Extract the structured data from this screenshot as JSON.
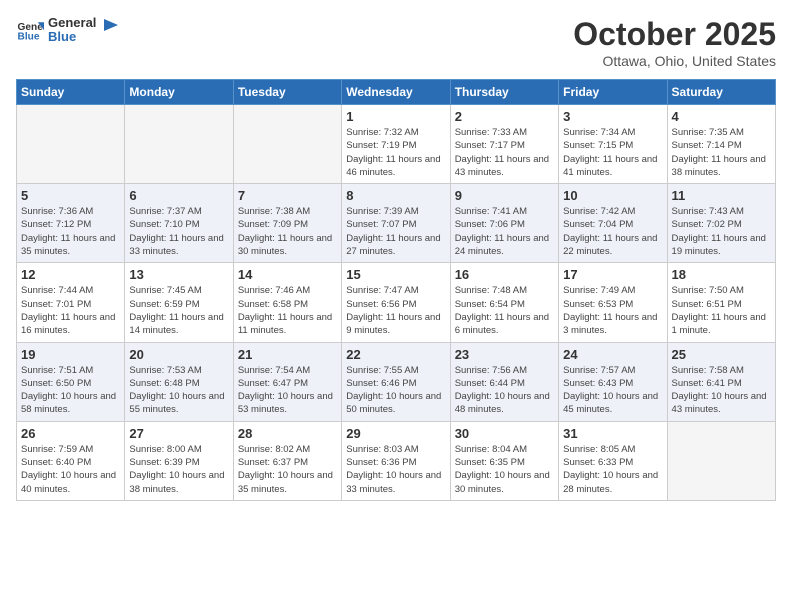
{
  "logo": {
    "general": "General",
    "blue": "Blue"
  },
  "header": {
    "month": "October 2025",
    "location": "Ottawa, Ohio, United States"
  },
  "weekdays": [
    "Sunday",
    "Monday",
    "Tuesday",
    "Wednesday",
    "Thursday",
    "Friday",
    "Saturday"
  ],
  "weeks": [
    [
      {
        "day": "",
        "info": ""
      },
      {
        "day": "",
        "info": ""
      },
      {
        "day": "",
        "info": ""
      },
      {
        "day": "1",
        "info": "Sunrise: 7:32 AM\nSunset: 7:19 PM\nDaylight: 11 hours and 46 minutes."
      },
      {
        "day": "2",
        "info": "Sunrise: 7:33 AM\nSunset: 7:17 PM\nDaylight: 11 hours and 43 minutes."
      },
      {
        "day": "3",
        "info": "Sunrise: 7:34 AM\nSunset: 7:15 PM\nDaylight: 11 hours and 41 minutes."
      },
      {
        "day": "4",
        "info": "Sunrise: 7:35 AM\nSunset: 7:14 PM\nDaylight: 11 hours and 38 minutes."
      }
    ],
    [
      {
        "day": "5",
        "info": "Sunrise: 7:36 AM\nSunset: 7:12 PM\nDaylight: 11 hours and 35 minutes."
      },
      {
        "day": "6",
        "info": "Sunrise: 7:37 AM\nSunset: 7:10 PM\nDaylight: 11 hours and 33 minutes."
      },
      {
        "day": "7",
        "info": "Sunrise: 7:38 AM\nSunset: 7:09 PM\nDaylight: 11 hours and 30 minutes."
      },
      {
        "day": "8",
        "info": "Sunrise: 7:39 AM\nSunset: 7:07 PM\nDaylight: 11 hours and 27 minutes."
      },
      {
        "day": "9",
        "info": "Sunrise: 7:41 AM\nSunset: 7:06 PM\nDaylight: 11 hours and 24 minutes."
      },
      {
        "day": "10",
        "info": "Sunrise: 7:42 AM\nSunset: 7:04 PM\nDaylight: 11 hours and 22 minutes."
      },
      {
        "day": "11",
        "info": "Sunrise: 7:43 AM\nSunset: 7:02 PM\nDaylight: 11 hours and 19 minutes."
      }
    ],
    [
      {
        "day": "12",
        "info": "Sunrise: 7:44 AM\nSunset: 7:01 PM\nDaylight: 11 hours and 16 minutes."
      },
      {
        "day": "13",
        "info": "Sunrise: 7:45 AM\nSunset: 6:59 PM\nDaylight: 11 hours and 14 minutes."
      },
      {
        "day": "14",
        "info": "Sunrise: 7:46 AM\nSunset: 6:58 PM\nDaylight: 11 hours and 11 minutes."
      },
      {
        "day": "15",
        "info": "Sunrise: 7:47 AM\nSunset: 6:56 PM\nDaylight: 11 hours and 9 minutes."
      },
      {
        "day": "16",
        "info": "Sunrise: 7:48 AM\nSunset: 6:54 PM\nDaylight: 11 hours and 6 minutes."
      },
      {
        "day": "17",
        "info": "Sunrise: 7:49 AM\nSunset: 6:53 PM\nDaylight: 11 hours and 3 minutes."
      },
      {
        "day": "18",
        "info": "Sunrise: 7:50 AM\nSunset: 6:51 PM\nDaylight: 11 hours and 1 minute."
      }
    ],
    [
      {
        "day": "19",
        "info": "Sunrise: 7:51 AM\nSunset: 6:50 PM\nDaylight: 10 hours and 58 minutes."
      },
      {
        "day": "20",
        "info": "Sunrise: 7:53 AM\nSunset: 6:48 PM\nDaylight: 10 hours and 55 minutes."
      },
      {
        "day": "21",
        "info": "Sunrise: 7:54 AM\nSunset: 6:47 PM\nDaylight: 10 hours and 53 minutes."
      },
      {
        "day": "22",
        "info": "Sunrise: 7:55 AM\nSunset: 6:46 PM\nDaylight: 10 hours and 50 minutes."
      },
      {
        "day": "23",
        "info": "Sunrise: 7:56 AM\nSunset: 6:44 PM\nDaylight: 10 hours and 48 minutes."
      },
      {
        "day": "24",
        "info": "Sunrise: 7:57 AM\nSunset: 6:43 PM\nDaylight: 10 hours and 45 minutes."
      },
      {
        "day": "25",
        "info": "Sunrise: 7:58 AM\nSunset: 6:41 PM\nDaylight: 10 hours and 43 minutes."
      }
    ],
    [
      {
        "day": "26",
        "info": "Sunrise: 7:59 AM\nSunset: 6:40 PM\nDaylight: 10 hours and 40 minutes."
      },
      {
        "day": "27",
        "info": "Sunrise: 8:00 AM\nSunset: 6:39 PM\nDaylight: 10 hours and 38 minutes."
      },
      {
        "day": "28",
        "info": "Sunrise: 8:02 AM\nSunset: 6:37 PM\nDaylight: 10 hours and 35 minutes."
      },
      {
        "day": "29",
        "info": "Sunrise: 8:03 AM\nSunset: 6:36 PM\nDaylight: 10 hours and 33 minutes."
      },
      {
        "day": "30",
        "info": "Sunrise: 8:04 AM\nSunset: 6:35 PM\nDaylight: 10 hours and 30 minutes."
      },
      {
        "day": "31",
        "info": "Sunrise: 8:05 AM\nSunset: 6:33 PM\nDaylight: 10 hours and 28 minutes."
      },
      {
        "day": "",
        "info": ""
      }
    ]
  ]
}
